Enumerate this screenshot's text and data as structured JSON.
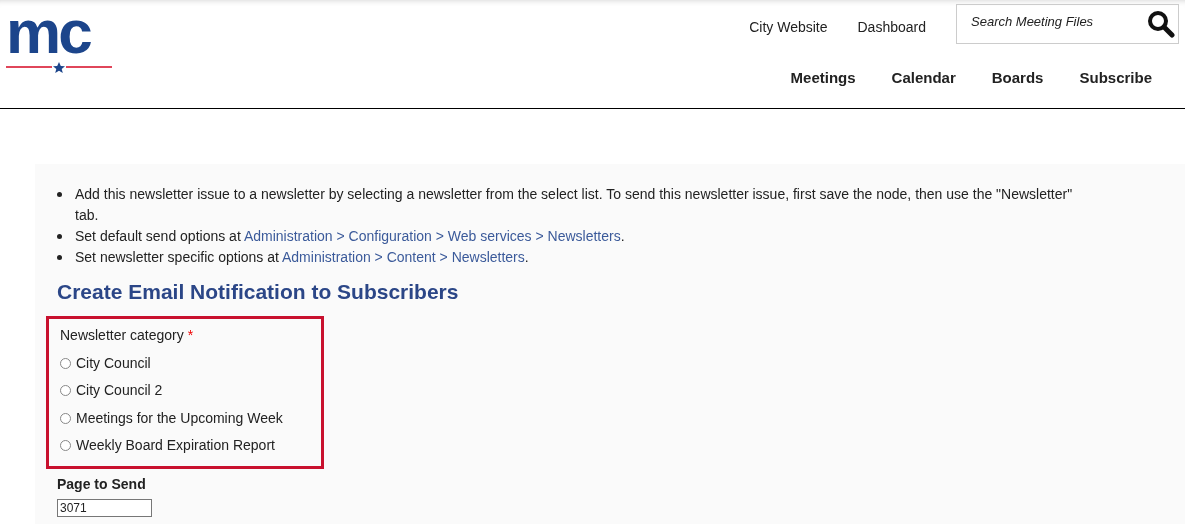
{
  "logo": {
    "text": "mc"
  },
  "top_links": [
    "City Website",
    "Dashboard"
  ],
  "search": {
    "placeholder": "Search Meeting Files"
  },
  "main_nav": [
    "Meetings",
    "Calendar",
    "Boards",
    "Subscribe"
  ],
  "help_items": [
    {
      "parts": [
        {
          "kind": "text",
          "text": "Add this newsletter issue to a newsletter by selecting a newsletter from the select list. To send this newsletter issue, first save the node, then use the \"Newsletter\" tab."
        }
      ]
    },
    {
      "parts": [
        {
          "kind": "text",
          "text": "Set default send options at "
        },
        {
          "kind": "link",
          "text": "Administration > Configuration > Web services > Newsletters"
        },
        {
          "kind": "text",
          "text": "."
        }
      ]
    },
    {
      "parts": [
        {
          "kind": "text",
          "text": "Set newsletter specific options at "
        },
        {
          "kind": "link",
          "text": "Administration > Content > Newsletters"
        },
        {
          "kind": "text",
          "text": "."
        }
      ]
    }
  ],
  "heading": "Create Email Notification to Subscribers",
  "newsletter_category": {
    "label": "Newsletter category",
    "required": true,
    "required_mark": "*",
    "highlighted": true,
    "options": [
      {
        "label": "City Council",
        "selected": false
      },
      {
        "label": "City Council 2",
        "selected": false
      },
      {
        "label": "Meetings for the Upcoming Week",
        "selected": false
      },
      {
        "label": "Weekly Board Expiration Report",
        "selected": false
      }
    ]
  },
  "page_to_send": {
    "label": "Page to Send",
    "value": "3071"
  }
}
